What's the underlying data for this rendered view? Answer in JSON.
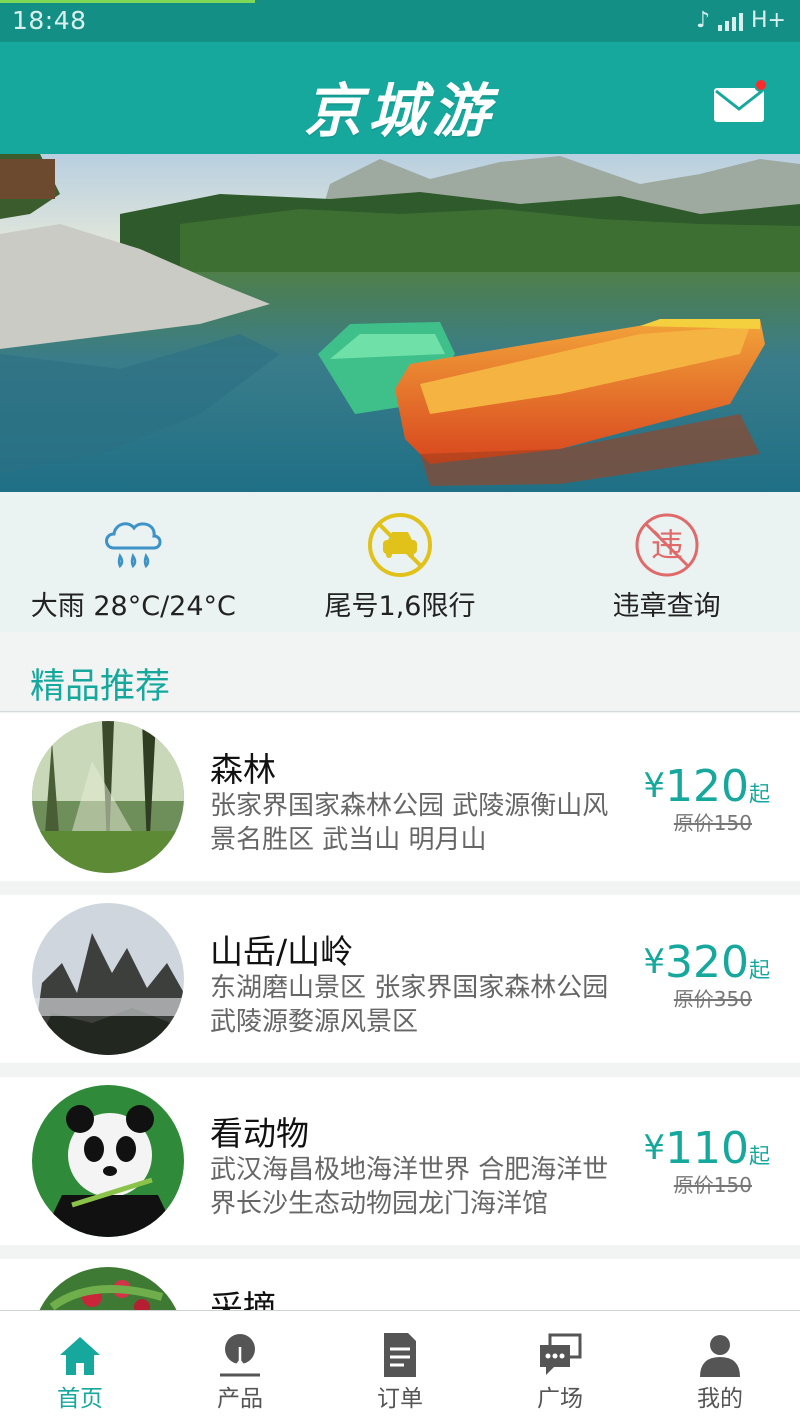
{
  "status_bar": {
    "time": "18:48",
    "network": "H+"
  },
  "app_bar": {
    "title": "京城游"
  },
  "quick_actions": [
    {
      "icon": "rain-cloud-icon",
      "label": "大雨 28°C/24°C"
    },
    {
      "icon": "no-car-icon",
      "label": "尾号1,6限行"
    },
    {
      "icon": "violation-icon",
      "label": "违章查询",
      "glyph": "违"
    }
  ],
  "section": {
    "title": "精品推荐"
  },
  "recommendations": [
    {
      "name": "森林",
      "desc": "张家界国家森林公园 武陵源衡山风景名胜区  武当山 明月山",
      "currency": "¥",
      "price": "120",
      "suffix": "起",
      "original": "原价150"
    },
    {
      "name": "山岳/山岭",
      "desc": "东湖磨山景区 张家界国家森林公园 武陵源婺源风景区",
      "currency": "¥",
      "price": "320",
      "suffix": "起",
      "original": "原价350"
    },
    {
      "name": "看动物",
      "desc": "武汉海昌极地海洋世界 合肥海洋世界长沙生态动物园龙门海洋馆",
      "currency": "¥",
      "price": "110",
      "suffix": "起",
      "original": "原价150"
    },
    {
      "name": "采摘"
    }
  ],
  "tabs": [
    {
      "label": "首页",
      "icon": "home-icon",
      "active": true
    },
    {
      "label": "产品",
      "icon": "product-icon"
    },
    {
      "label": "订单",
      "icon": "order-icon"
    },
    {
      "label": "广场",
      "icon": "chat-bubbles-icon"
    },
    {
      "label": "我的",
      "icon": "user-icon"
    }
  ],
  "colors": {
    "primary": "#16a89d",
    "status_bar": "#148f86",
    "badge": "#ff2a2a"
  }
}
